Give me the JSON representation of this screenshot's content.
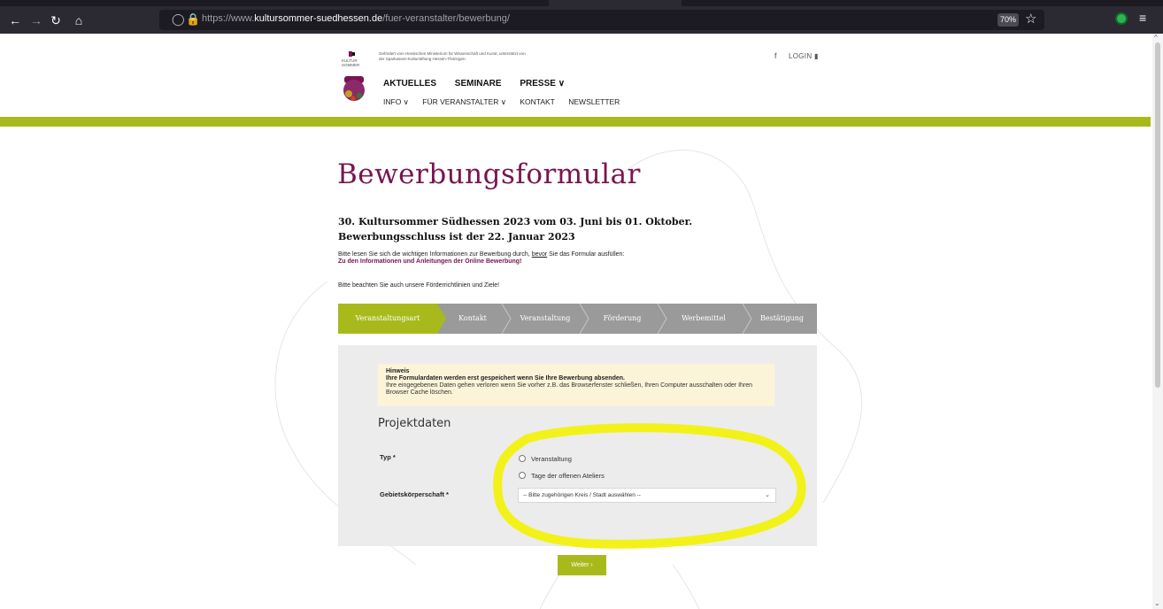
{
  "browser": {
    "url_prefix": "https://www.",
    "url_domain": "kultursommer-suedhessen.de",
    "url_path": "/fuer-veranstalter/bewerbung/",
    "zoom": "70%"
  },
  "header": {
    "logo_text": "KULTUR SOMMER",
    "support_text": "Gefördert vom Hessischen Ministerium für Wissenschaft und Kunst, unterstützt von der Sparkassen-Kulturstiftung Hessen-Thüringen.",
    "social": "f",
    "login": "LOGIN",
    "main_nav": [
      "AKTUELLES",
      "SEMINARE",
      "PRESSE ∨"
    ],
    "sub_nav": [
      "INFO ∨",
      "FÜR VERANSTALTER ∨",
      "KONTAKT",
      "NEWSLETTER"
    ]
  },
  "content": {
    "title": "Bewerbungsformular",
    "subtitle_line1": "30. Kultursommer Südhessen 2023 vom 03. Juni bis 01. Oktober.",
    "subtitle_line2": "Bewerbungsschluss ist der 22. Januar 2023",
    "info_before": "Bitte lesen Sie sich die wichtigen Informationen zur Bewerbung durch,",
    "info_under": "bevor",
    "info_after": "Sie das Formular ausfüllen:",
    "info_link": "Zu den Informationen und Anleitungen der Online Bewerbung!",
    "note": "Bitte beachten Sie auch unsere Förderrichtlinien und Ziele!"
  },
  "steps": [
    "Veranstaltungsart",
    "Kontakt",
    "Veranstaltung",
    "Förderung",
    "Werbemittel",
    "Bestätigung"
  ],
  "form": {
    "hint_title": "Hinweis",
    "hint_bold": "Ihre Formulardaten werden erst gespeichert wenn Sie Ihre Bewerbung absenden.",
    "hint_text": "Ihre eingegebenen Daten gehen verloren wenn Sie vorher z.B. das Browserfenster schließen, Ihren Computer ausschalten oder Ihren Browser Cache löschen.",
    "section_title": "Projektdaten",
    "typ_label": "Typ *",
    "typ_options": [
      "Veranstaltung",
      "Tage der offenen Ateliers"
    ],
    "gebiet_label": "Gebietskörperschaft *",
    "gebiet_placeholder": "-- Bitte zugehörigen Kreis / Stadt auswählen --",
    "next_label": "Weiter ›"
  },
  "colors": {
    "accent_green": "#a8ba1b",
    "brand_purple": "#7a1450",
    "highlight_yellow": "#f2f21a"
  }
}
